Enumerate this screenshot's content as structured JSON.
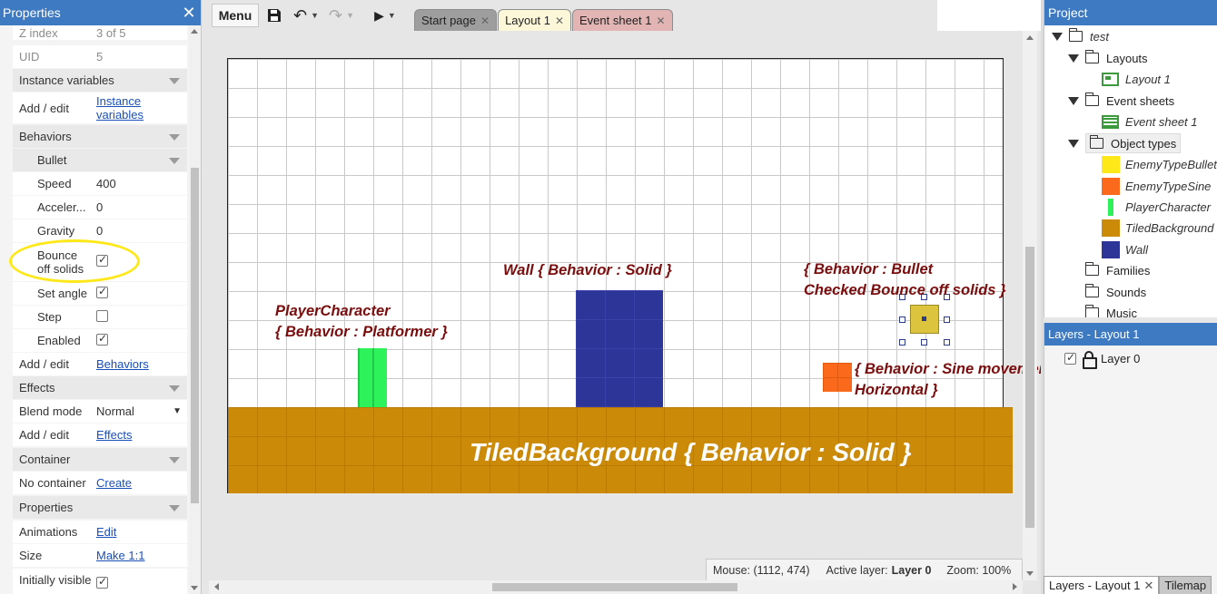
{
  "properties_panel": {
    "title": "Properties",
    "rows": [
      {
        "key": "Z index",
        "value": "3 of 5"
      },
      {
        "key": "UID",
        "value": "5"
      },
      {
        "section": "Instance variables"
      },
      {
        "key": "Add / edit",
        "link": "Instance variables"
      },
      {
        "section": "Behaviors"
      },
      {
        "subsection": "Bullet"
      },
      {
        "key": "Speed",
        "value": "400"
      },
      {
        "key": "Acceler...",
        "value": "0"
      },
      {
        "key": "Gravity",
        "value": "0"
      },
      {
        "key": "Bounce off solids",
        "checked": true
      },
      {
        "key": "Set angle",
        "checked": true
      },
      {
        "key": "Step",
        "checked": false
      },
      {
        "key": "Enabled",
        "checked": true
      },
      {
        "key": "Add / edit",
        "link": "Behaviors"
      },
      {
        "section": "Effects"
      },
      {
        "key": "Blend mode",
        "value": "Normal"
      },
      {
        "key": "Add / edit",
        "link": "Effects"
      },
      {
        "section": "Container"
      },
      {
        "key": "No container",
        "link": "Create"
      },
      {
        "section": "Properties"
      },
      {
        "key": "Animations",
        "link": "Edit"
      },
      {
        "key": "Size",
        "link": "Make 1:1"
      },
      {
        "key": "Initially visible",
        "checked": true
      }
    ]
  },
  "toolbar": {
    "menu_label": "Menu",
    "tabs": [
      {
        "label": "Start page",
        "state": "inactive"
      },
      {
        "label": "Layout 1",
        "state": "active"
      },
      {
        "label": "Event sheet 1",
        "state": "inactive"
      }
    ]
  },
  "layout_view": {
    "annotations": {
      "player": [
        "PlayerCharacter",
        "{ Behavior : Platformer }"
      ],
      "wall": "Wall { Behavior : Solid }",
      "bullet": [
        "{ Behavior : Bullet",
        "Checked Bounce off solids }"
      ],
      "sine": [
        "{ Behavior : Sine movement",
        "Horizontal }"
      ],
      "tiled": "TiledBackground { Behavior : Solid }"
    },
    "status": {
      "mouse": "Mouse: (1112, 474)",
      "active_layer_label": "Active layer:",
      "active_layer": "Layer 0",
      "zoom": "Zoom: 100%"
    }
  },
  "project_panel": {
    "title": "Project",
    "root": "test",
    "layouts_folder": "Layouts",
    "layout_item": "Layout 1",
    "event_sheets_folder": "Event sheets",
    "event_sheet_item": "Event sheet 1",
    "object_types_folder": "Object types",
    "object_types": [
      {
        "name": "EnemyTypeBullet",
        "color": "#ffe81a"
      },
      {
        "name": "EnemyTypeSine",
        "color": "#fb6a1c"
      },
      {
        "name": "PlayerCharacter",
        "color": "#2ef25a"
      },
      {
        "name": "TiledBackground",
        "color": "#cc8a09"
      },
      {
        "name": "Wall",
        "color": "#2e3599"
      }
    ],
    "families_folder": "Families",
    "sounds_folder": "Sounds",
    "music_folder": "Music"
  },
  "layers_panel": {
    "title": "Layers - Layout 1",
    "layer": "Layer 0",
    "layer_visible": true
  },
  "bottom_tabs": [
    {
      "label": "Layers - Layout 1",
      "state": "active"
    },
    {
      "label": "Tilemap",
      "state": "inactive"
    }
  ],
  "colors": {
    "accent": "#3d7ac2",
    "annotation": "#7a0d0d",
    "highlight_ring": "#ffe81a"
  }
}
